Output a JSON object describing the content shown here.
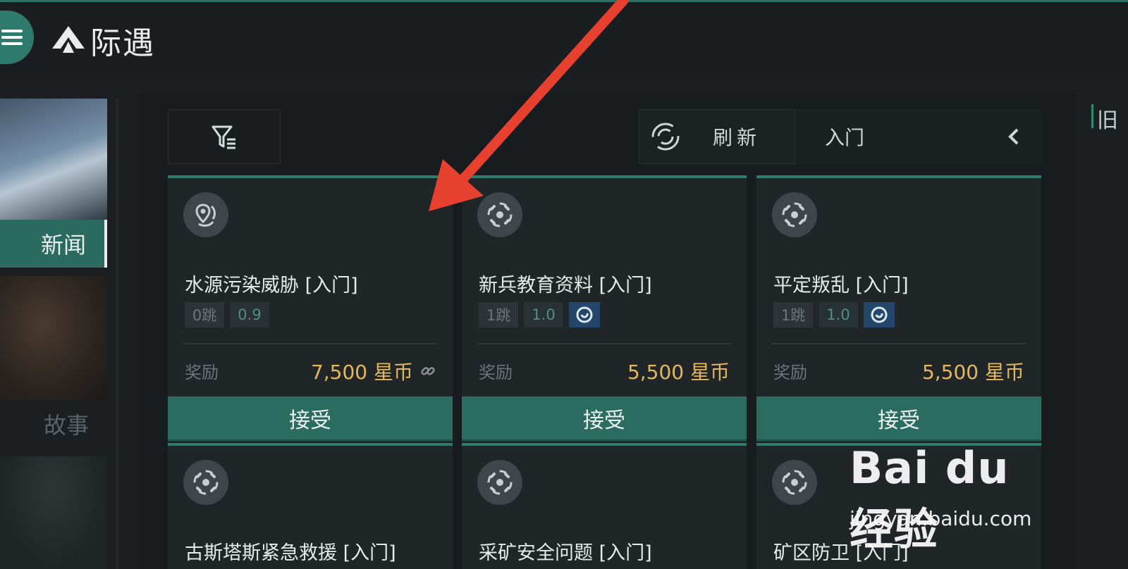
{
  "app": {
    "title": "际遇"
  },
  "left_nav": {
    "items": [
      {
        "label": "新闻"
      },
      {
        "label": "故事"
      }
    ]
  },
  "toolbar": {
    "refresh_label": "刷新",
    "level_value": "入门"
  },
  "right_tab": {
    "glyph": "旧"
  },
  "cards": [
    {
      "title": "水源污染威胁 [入门]",
      "jump": "0跳",
      "security": "0.9",
      "reward_label": "奖励",
      "reward": "7,500 星币",
      "accept": "接受",
      "icon": "map-pin-icon"
    },
    {
      "title": "新兵教育资料 [入门]",
      "jump": "1跳",
      "security": "1.0",
      "reward_label": "奖励",
      "reward": "5,500 星币",
      "accept": "接受",
      "icon": "target-icon"
    },
    {
      "title": "平定叛乱 [入门]",
      "jump": "1跳",
      "security": "1.0",
      "reward_label": "奖励",
      "reward": "5,500 星币",
      "accept": "接受",
      "icon": "target-icon"
    },
    {
      "title": "古斯塔斯紧急救援 [入门]",
      "icon": "target-icon"
    },
    {
      "title": "采矿安全问题 [入门]",
      "icon": "target-icon"
    },
    {
      "title": "矿区防卫 [入门]",
      "icon": "target-icon"
    }
  ],
  "watermark": {
    "logo": "Bai du 经验",
    "url": "jingyan.baidu.com"
  },
  "colors": {
    "accent": "#2e7a6c",
    "reward": "#e3b85c",
    "background": "#1b1f22",
    "arrow": "#e8402f"
  }
}
